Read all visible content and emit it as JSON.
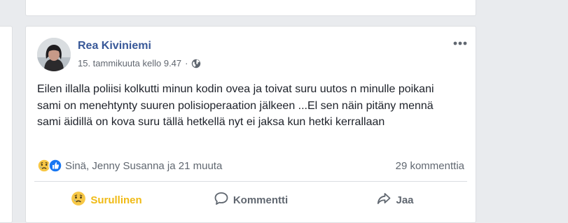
{
  "post": {
    "author": "Rea Kiviniemi",
    "timestamp": "15. tammikuuta kello 9.47",
    "separator": "·",
    "privacy_icon": "globe-icon",
    "body": "Eilen illalla poliisi kolkutti minun kodin ovea ja toivat suru uutos n minulle poikani sami on menehtynty suuren polisioperaation jälkeen ...El sen näin pitäny mennä sami äidillä on kova suru tällä hetkellä nyt ei jaksa kun hetki kerrallaan",
    "reactions_summary": "Sinä, Jenny Susanna ja 21 muuta",
    "comments_count": "29 kommenttia"
  },
  "actions": {
    "react_label": "Surullinen",
    "comment_label": "Kommentti",
    "share_label": "Jaa"
  },
  "colors": {
    "author": "#385898",
    "sad_yellow": "#f0ba15",
    "like_blue": "#1877f2"
  }
}
